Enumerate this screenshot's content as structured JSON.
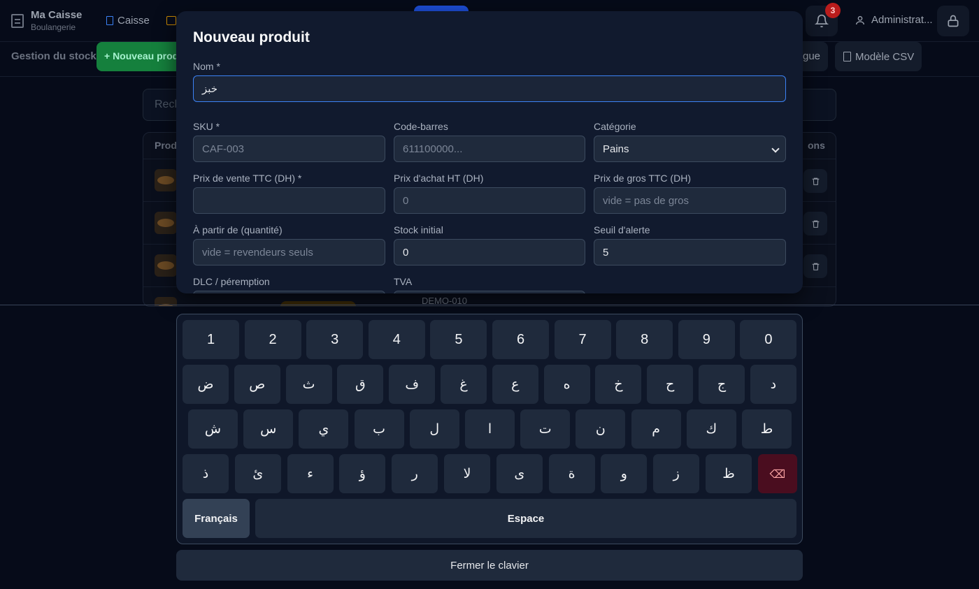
{
  "app": {
    "name": "Ma Caisse",
    "store": "Boulangerie",
    "nav_caisse": "Caisse",
    "notifications_count": "3",
    "user": "Administrat..."
  },
  "page": {
    "title": "Gestion du stock",
    "new_product_btn": "+ Nouveau prod",
    "catalogue_btn": "gue",
    "csv_btn": "Modèle CSV",
    "search_placeholder": "Rech",
    "table_header_product": "Prod",
    "table_header_actions": "ons",
    "last_row_sku": "DEMO-010",
    "last_row_price": "..."
  },
  "modal": {
    "title": "Nouveau produit",
    "fields": {
      "name": {
        "label": "Nom *",
        "value": "خبز"
      },
      "sku": {
        "label": "SKU *",
        "placeholder": "CAF-003"
      },
      "barcode": {
        "label": "Code-barres",
        "placeholder": "611100000..."
      },
      "category": {
        "label": "Catégorie",
        "value": "Pains"
      },
      "sale_price": {
        "label": "Prix de vente TTC (DH) *",
        "value": ""
      },
      "purchase_price": {
        "label": "Prix d'achat HT (DH)",
        "placeholder": "0"
      },
      "wholesale_price": {
        "label": "Prix de gros TTC (DH)",
        "placeholder": "vide = pas de gros"
      },
      "from_qty": {
        "label": "À partir de (quantité)",
        "placeholder": "vide = revendeurs seuls"
      },
      "initial_stock": {
        "label": "Stock initial",
        "value": "0"
      },
      "alert_threshold": {
        "label": "Seuil d'alerte",
        "value": "5"
      },
      "expiry": {
        "label": "DLC / péremption"
      },
      "vat": {
        "label": "TVA"
      }
    }
  },
  "keyboard": {
    "row_numbers": [
      "1",
      "2",
      "3",
      "4",
      "5",
      "6",
      "7",
      "8",
      "9",
      "0"
    ],
    "row1": [
      "ض",
      "ص",
      "ث",
      "ق",
      "ف",
      "غ",
      "ع",
      "ه",
      "خ",
      "ح",
      "ج",
      "د"
    ],
    "row2": [
      "ش",
      "س",
      "ي",
      "ب",
      "ل",
      "ا",
      "ت",
      "ن",
      "م",
      "ك",
      "ط"
    ],
    "row3": [
      "ذ",
      "ئ",
      "ء",
      "ؤ",
      "ر",
      "لا",
      "ى",
      "ة",
      "و",
      "ز",
      "ظ"
    ],
    "backspace": "⌫",
    "language": "Français",
    "space": "Espace",
    "close": "Fermer le clavier"
  }
}
